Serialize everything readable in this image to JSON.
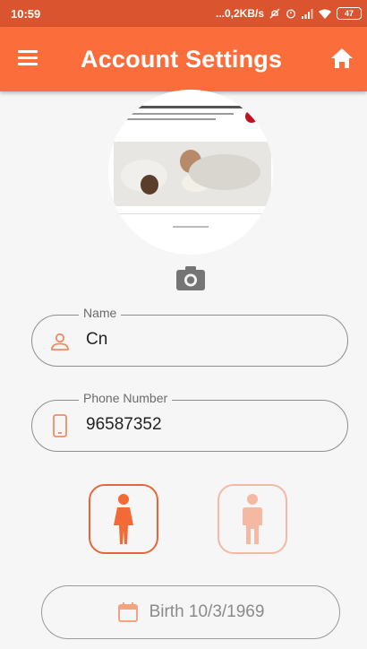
{
  "status_bar": {
    "time": "10:59",
    "network": "...0,2KB/s",
    "battery": "47"
  },
  "app_bar": {
    "title": "Account Settings",
    "menu_icon": "hamburger-menu-icon",
    "home_icon": "home-icon",
    "background": "#fb6d3a"
  },
  "profile": {
    "photo_icon": "camera-icon"
  },
  "form": {
    "name": {
      "label": "Name",
      "value": "Cn",
      "icon": "person-icon"
    },
    "phone": {
      "label": "Phone Number",
      "value": "96587352",
      "icon": "phone-icon"
    }
  },
  "gender": {
    "female_icon": "female-icon",
    "male_icon": "male-icon",
    "selected": "female"
  },
  "birth": {
    "text": "Birth 10/3/1969",
    "icon": "calendar-icon"
  },
  "colors": {
    "accent": "#fb6d3a",
    "accent_light": "#f5b9a3"
  }
}
